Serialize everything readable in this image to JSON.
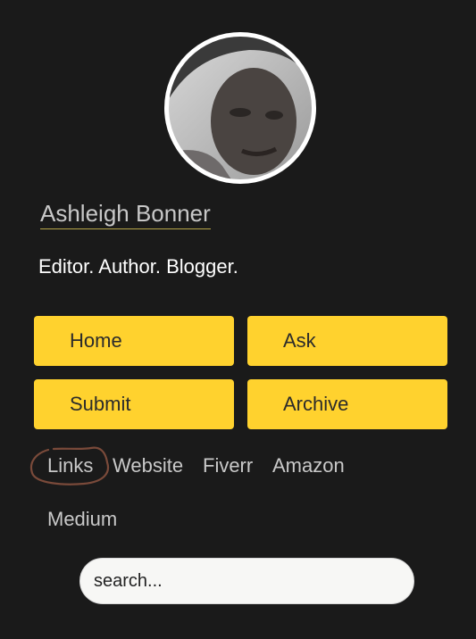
{
  "profile": {
    "name": "Ashleigh Bonner",
    "tagline": "Editor. Author. Blogger."
  },
  "nav": {
    "home": "Home",
    "ask": "Ask",
    "submit": "Submit",
    "archive": "Archive"
  },
  "links": [
    "Links",
    "Website",
    "Fiverr",
    "Amazon",
    "Medium"
  ],
  "search": {
    "placeholder": "search..."
  },
  "colors": {
    "background": "#1a1a1a",
    "button": "#ffd22e",
    "link": "#c9c9c9",
    "annotation_circle": "#7a4a3a"
  },
  "icons": [
    "avatar-photo",
    "hand-drawn-circle-annotation"
  ]
}
